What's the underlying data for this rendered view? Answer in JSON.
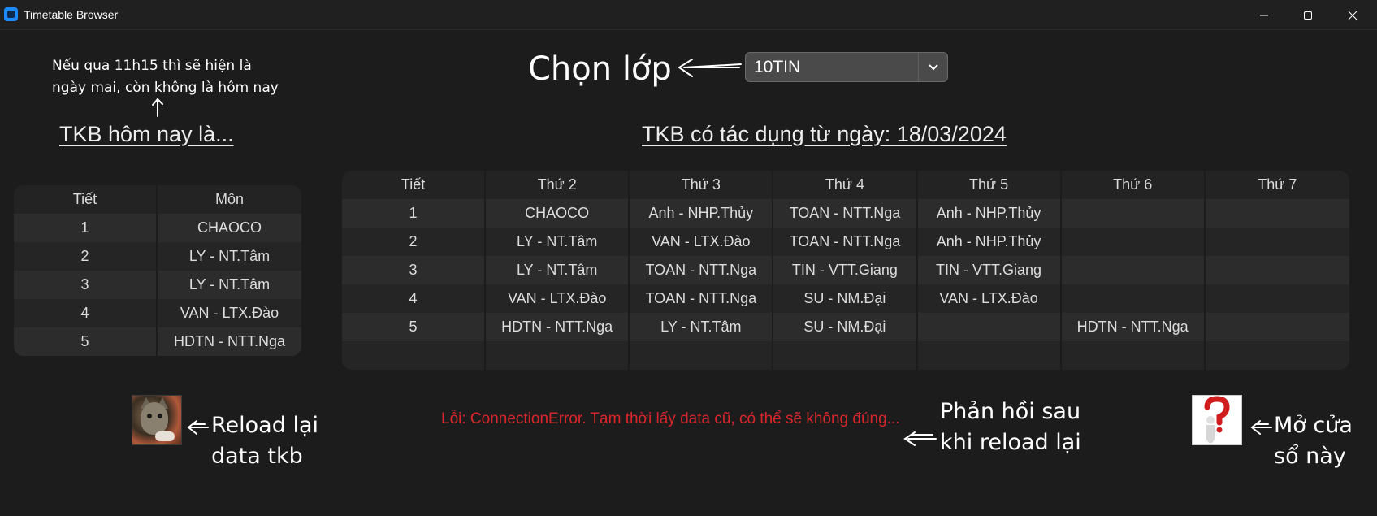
{
  "window": {
    "title": "Timetable Browser"
  },
  "annotations": {
    "top_note_line1": "Nếu qua 11h15 thì sẽ hiện là",
    "top_note_line2": "ngày mai, còn không là hôm nay",
    "select_class": "Chọn lớp",
    "reload_line1": "Reload lại",
    "reload_line2": "data tkb",
    "feedback_line1": "Phản hồi sau",
    "feedback_line2": "khi reload lại",
    "open_line1": "Mở cửa",
    "open_line2": "sổ này"
  },
  "class_select": {
    "value": "10TIN"
  },
  "today": {
    "heading": "TKB hôm nay là...",
    "columns": [
      "Tiết",
      "Môn"
    ],
    "rows": [
      [
        "1",
        "CHAOCO"
      ],
      [
        "2",
        "LY - NT.Tâm"
      ],
      [
        "3",
        "LY - NT.Tâm"
      ],
      [
        "4",
        "VAN - LTX.Đào"
      ],
      [
        "5",
        "HDTN - NTT.Nga"
      ]
    ]
  },
  "week": {
    "heading": "TKB có tác dụng từ ngày: 18/03/2024",
    "columns": [
      "Tiết",
      "Thứ 2",
      "Thứ 3",
      "Thứ 4",
      "Thứ 5",
      "Thứ 6",
      "Thứ 7"
    ],
    "rows": [
      [
        "1",
        "CHAOCO",
        "Anh - NHP.Thủy",
        "TOAN - NTT.Nga",
        "Anh - NHP.Thủy",
        "",
        ""
      ],
      [
        "2",
        "LY - NT.Tâm",
        "VAN - LTX.Đào",
        "TOAN - NTT.Nga",
        "Anh - NHP.Thủy",
        "",
        ""
      ],
      [
        "3",
        "LY - NT.Tâm",
        "TOAN - NTT.Nga",
        "TIN - VTT.Giang",
        "TIN - VTT.Giang",
        "",
        ""
      ],
      [
        "4",
        "VAN - LTX.Đào",
        "TOAN - NTT.Nga",
        "SU - NM.Đại",
        "VAN - LTX.Đào",
        "",
        ""
      ],
      [
        "5",
        "HDTN - NTT.Nga",
        "LY - NT.Tâm",
        "SU - NM.Đại",
        "",
        "HDTN - NTT.Nga",
        ""
      ],
      [
        "",
        "",
        "",
        "",
        "",
        "",
        ""
      ]
    ]
  },
  "status": {
    "error": "Lỗi: ConnectionError. Tạm thời lấy data cũ, có thể sẽ không đúng..."
  },
  "icons": {
    "reload": "cat-photo-icon",
    "help": "question-person-icon"
  },
  "colors": {
    "background": "#1c1c1c",
    "error": "#d8262c",
    "accent": "#1a8cff"
  }
}
